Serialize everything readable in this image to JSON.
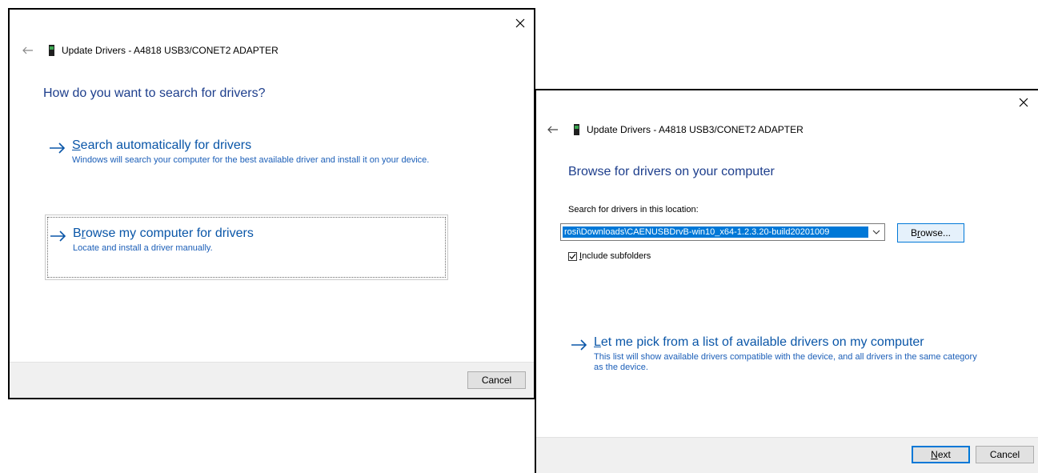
{
  "colors": {
    "heading": "#1d3e8c",
    "link": "#0a56a8",
    "link_desc": "#1c5fb8",
    "selection": "#0078d7",
    "footer_bg": "#f0f0f0"
  },
  "dialog1": {
    "title": "Update Drivers - A4818 USB3/CONET2 ADAPTER",
    "heading": "How do you want to search for drivers?",
    "options": [
      {
        "access_key": "S",
        "title_rest": "earch automatically for drivers",
        "description": "Windows will search your computer for the best available driver and install it on your device."
      },
      {
        "title_before": "B",
        "access_key": "r",
        "title_rest": "owse my computer for drivers",
        "description": "Locate and install a driver manually."
      }
    ],
    "cancel_label": "Cancel"
  },
  "dialog2": {
    "title": "Update Drivers - A4818 USB3/CONET2 ADAPTER",
    "heading": "Browse for drivers on your computer",
    "location_label": "Search for drivers in this location:",
    "path_value": "rosi\\Downloads\\CAENUSBDrvB-win10_x64-1.2.3.20-build20201009",
    "browse_access_key": "r",
    "browse_before": "B",
    "browse_rest": "owse...",
    "include_access_key": "I",
    "include_rest": "nclude subfolders",
    "include_checked": true,
    "pick_option": {
      "access_key": "L",
      "title_rest": "et me pick from a list of available drivers on my computer",
      "description": "This list will show available drivers compatible with the device, and all drivers in the same category as the device."
    },
    "next_access_key": "N",
    "next_rest": "ext",
    "cancel_label": "Cancel"
  }
}
